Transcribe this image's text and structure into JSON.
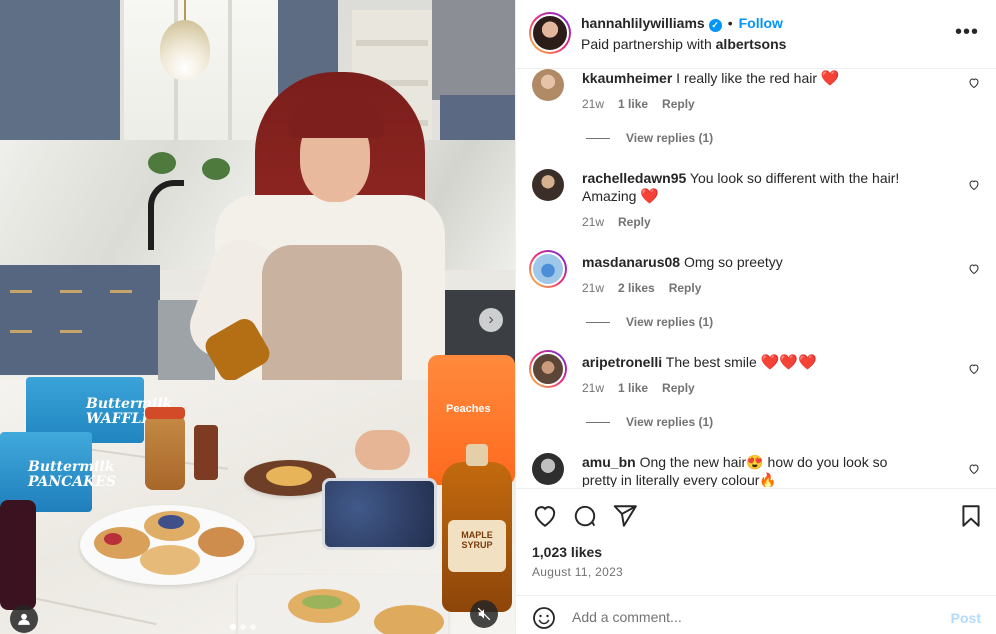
{
  "post": {
    "username": "hannahlilywilliams",
    "follow_label": "Follow",
    "separator": "•",
    "partner_prefix": "Paid partnership with ",
    "partner_name": "albertsons",
    "more_label": "•••"
  },
  "media": {
    "waffles_box_text": "Buttermilk WAFFLES",
    "pancakes_box_text": "Buttermilk PANCAKES",
    "syrup_label": "MAPLE SYRUP",
    "peaches_label": "Peaches",
    "next_glyph": "›"
  },
  "comments": [
    {
      "user": "kkaumheimer",
      "text": "I really like the red hair",
      "emoji": "❤️",
      "time": "21w",
      "likes": "1 like",
      "reply": "Reply",
      "view_replies": "View replies (1)"
    },
    {
      "user": "rachelledawn95",
      "text": "You look so different with the hair! Amazing",
      "emoji": "❤️",
      "time": "21w",
      "likes": "",
      "reply": "Reply",
      "view_replies": ""
    },
    {
      "user": "masdanarus08",
      "text": "Omg so preetyy",
      "emoji": "",
      "time": "21w",
      "likes": "2 likes",
      "reply": "Reply",
      "view_replies": "View replies (1)"
    },
    {
      "user": "aripetronelli",
      "text": "The best smile",
      "emoji": "❤️❤️❤️",
      "time": "21w",
      "likes": "1 like",
      "reply": "Reply",
      "view_replies": "View replies (1)"
    },
    {
      "user": "amu_bn",
      "text": "Ong the new hair",
      "emoji": "😍",
      "text2": "how do you look so pretty in literally every colour",
      "emoji2": "🔥",
      "time": "",
      "likes": "",
      "reply": "",
      "view_replies": ""
    }
  ],
  "stats": {
    "likes": "1,023 likes",
    "date": "August 11, 2023"
  },
  "composer": {
    "placeholder": "Add a comment...",
    "post_label": "Post"
  },
  "icons": [
    "heart-icon",
    "comment-icon",
    "share-icon",
    "bookmark-icon",
    "emoji-icon",
    "verified-icon",
    "more-icon",
    "user-tag-icon",
    "mute-icon",
    "chevron-right-icon"
  ],
  "colors": {
    "accent": "#0095f6",
    "heart": "#e0245e",
    "muted": "#737373",
    "post_disabled": "#b3dbff"
  }
}
